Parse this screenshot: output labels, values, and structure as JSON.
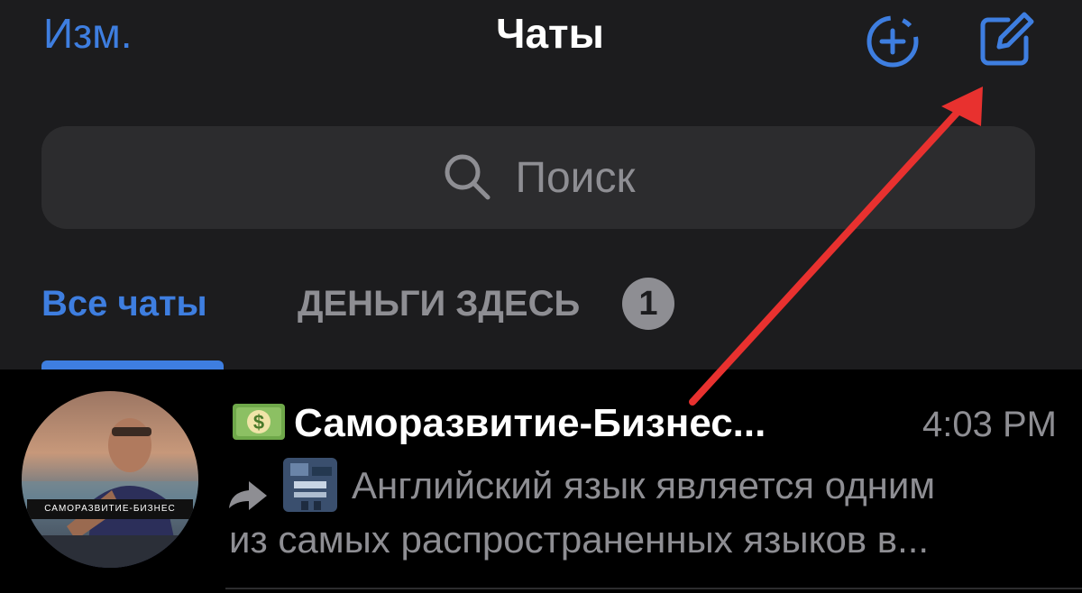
{
  "header": {
    "edit_label": "Изм.",
    "title": "Чаты",
    "new_story_icon": "plus-circle-dashed-icon",
    "compose_icon": "compose-square-pencil-icon"
  },
  "search": {
    "placeholder": "Поиск",
    "icon": "search-icon"
  },
  "tabs": [
    {
      "label": "Все чаты",
      "active": true
    },
    {
      "label": "ДЕНЬГИ ЗДЕСЬ",
      "badge": "1",
      "active": false
    }
  ],
  "chats": [
    {
      "emoji": "money-banknote-emoji",
      "name": "Саморазвитие-Бизнес...",
      "time": "4:03 PM",
      "avatar_caption": "САМОРАЗВИТИЕ-БИЗНЕС",
      "forwarded": true,
      "preview_line1": "Английский язык является одним",
      "preview_line2": "из самых распространенных языков в..."
    }
  ],
  "colors": {
    "accent": "#3e7ee0",
    "background": "#1c1c1e",
    "search_bg": "#2c2c2e",
    "secondary_text": "#8e8e93",
    "annotation_arrow": "#e8312f"
  }
}
